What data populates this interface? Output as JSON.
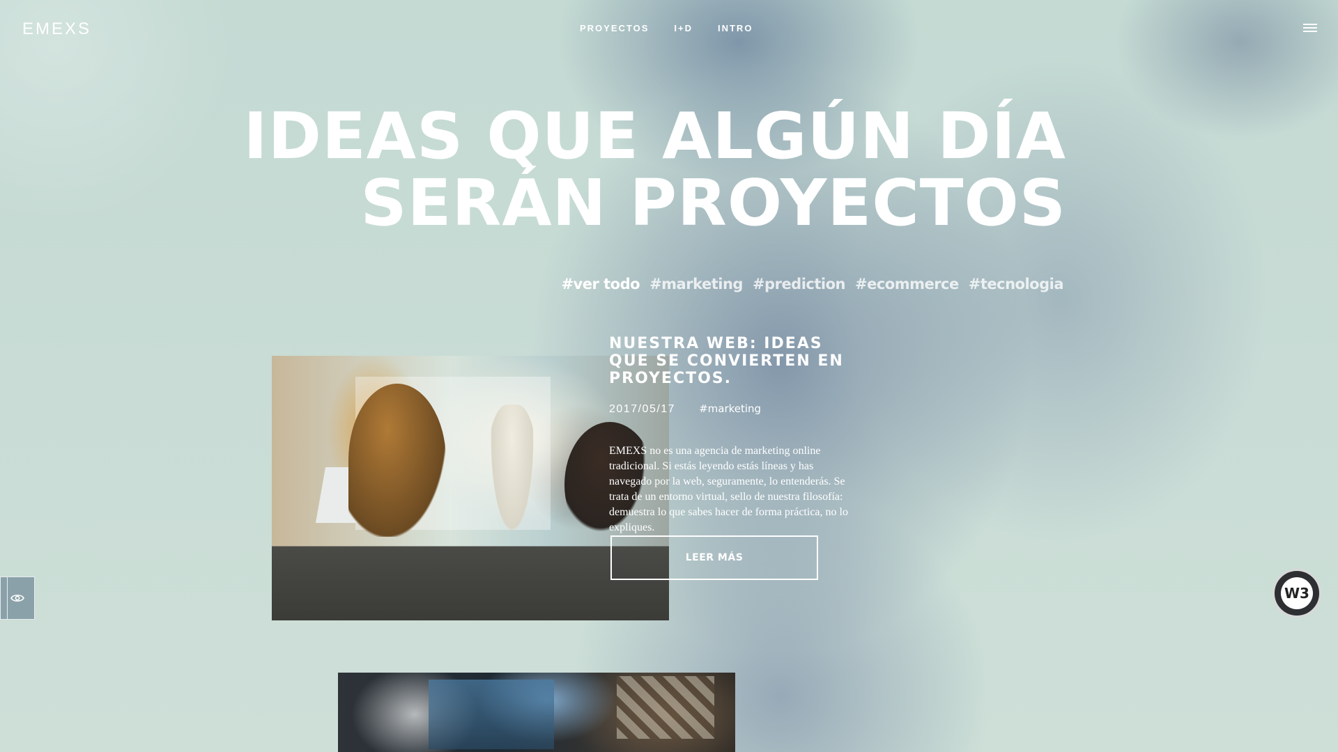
{
  "brand": {
    "logo_text": "EMEXS"
  },
  "nav": {
    "items": [
      {
        "label": "PROYECTOS"
      },
      {
        "label": "I+D"
      },
      {
        "label": "INTRO"
      }
    ]
  },
  "hero": {
    "title_line1": "IDEAS QUE ALGÚN DÍA",
    "title_line2": "SERÁN PROYECTOS"
  },
  "tags": [
    {
      "label": "#ver todo",
      "active": true
    },
    {
      "label": "#marketing"
    },
    {
      "label": "#prediction"
    },
    {
      "label": "#ecommerce"
    },
    {
      "label": "#tecnologia"
    }
  ],
  "article": {
    "title": "NUESTRA WEB: IDEAS QUE SE CONVIERTEN EN PROYECTOS.",
    "date": "2017/05/17",
    "category": "#marketing",
    "excerpt": "EMEXS no es una agencia de marketing online tradicional. Si estás leyendo estás líneas y has navegado por la web, seguramente, lo entenderás. Se trata de un entorno virtual, sello de nuestra filosofía: demuestra lo que sabes hacer de forma práctica, no lo expliques.",
    "read_more_label": "LEER MÁS"
  },
  "badge": {
    "text": "W3"
  },
  "icons": {
    "menu": "hamburger-icon",
    "eye": "eye-icon"
  }
}
